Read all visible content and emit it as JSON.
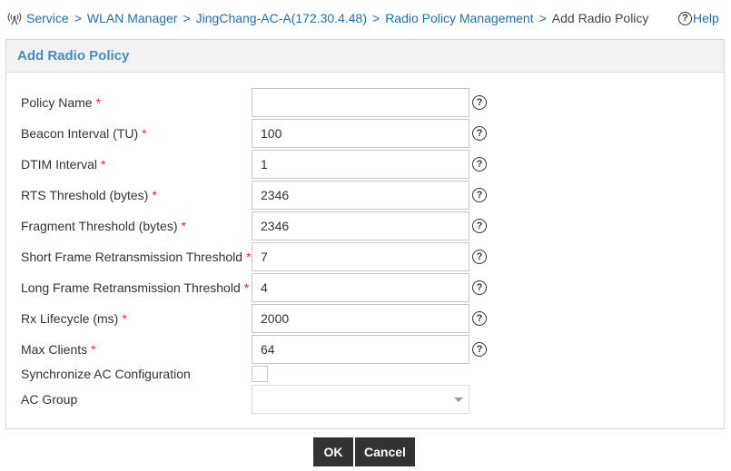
{
  "breadcrumb": {
    "icon": "wireless-antenna-icon",
    "items": [
      "Service",
      "WLAN Manager",
      "JingChang-AC-A(172.30.4.48)",
      "Radio Policy Management"
    ],
    "separator": ">",
    "current": "Add Radio Policy"
  },
  "help": {
    "icon": "question-circle-icon",
    "label": "Help"
  },
  "panel": {
    "title": "Add Radio Policy"
  },
  "form": {
    "required_marker": "*",
    "help_glyph": "?",
    "fields": [
      {
        "label": "Policy Name",
        "value": "",
        "required": true
      },
      {
        "label": "Beacon Interval (TU)",
        "value": "100",
        "required": true
      },
      {
        "label": "DTIM Interval",
        "value": "1",
        "required": true
      },
      {
        "label": "RTS Threshold (bytes)",
        "value": "2346",
        "required": true
      },
      {
        "label": "Fragment Threshold (bytes)",
        "value": "2346",
        "required": true
      },
      {
        "label": "Short Frame Retransmission Threshold",
        "value": "7",
        "required": true
      },
      {
        "label": "Long Frame Retransmission Threshold",
        "value": "4",
        "required": true
      },
      {
        "label": "Rx Lifecycle (ms)",
        "value": "2000",
        "required": true
      },
      {
        "label": "Max Clients",
        "value": "64",
        "required": true
      }
    ],
    "sync_ac": {
      "label": "Synchronize AC Configuration",
      "checked": false
    },
    "ac_group": {
      "label": "AC Group",
      "value": "",
      "disabled": true
    }
  },
  "buttons": {
    "ok": "OK",
    "cancel": "Cancel"
  },
  "colors": {
    "link": "#1f6fb2",
    "title": "#4a8cc7",
    "required": "#e0302a",
    "button_bg": "#333333"
  }
}
